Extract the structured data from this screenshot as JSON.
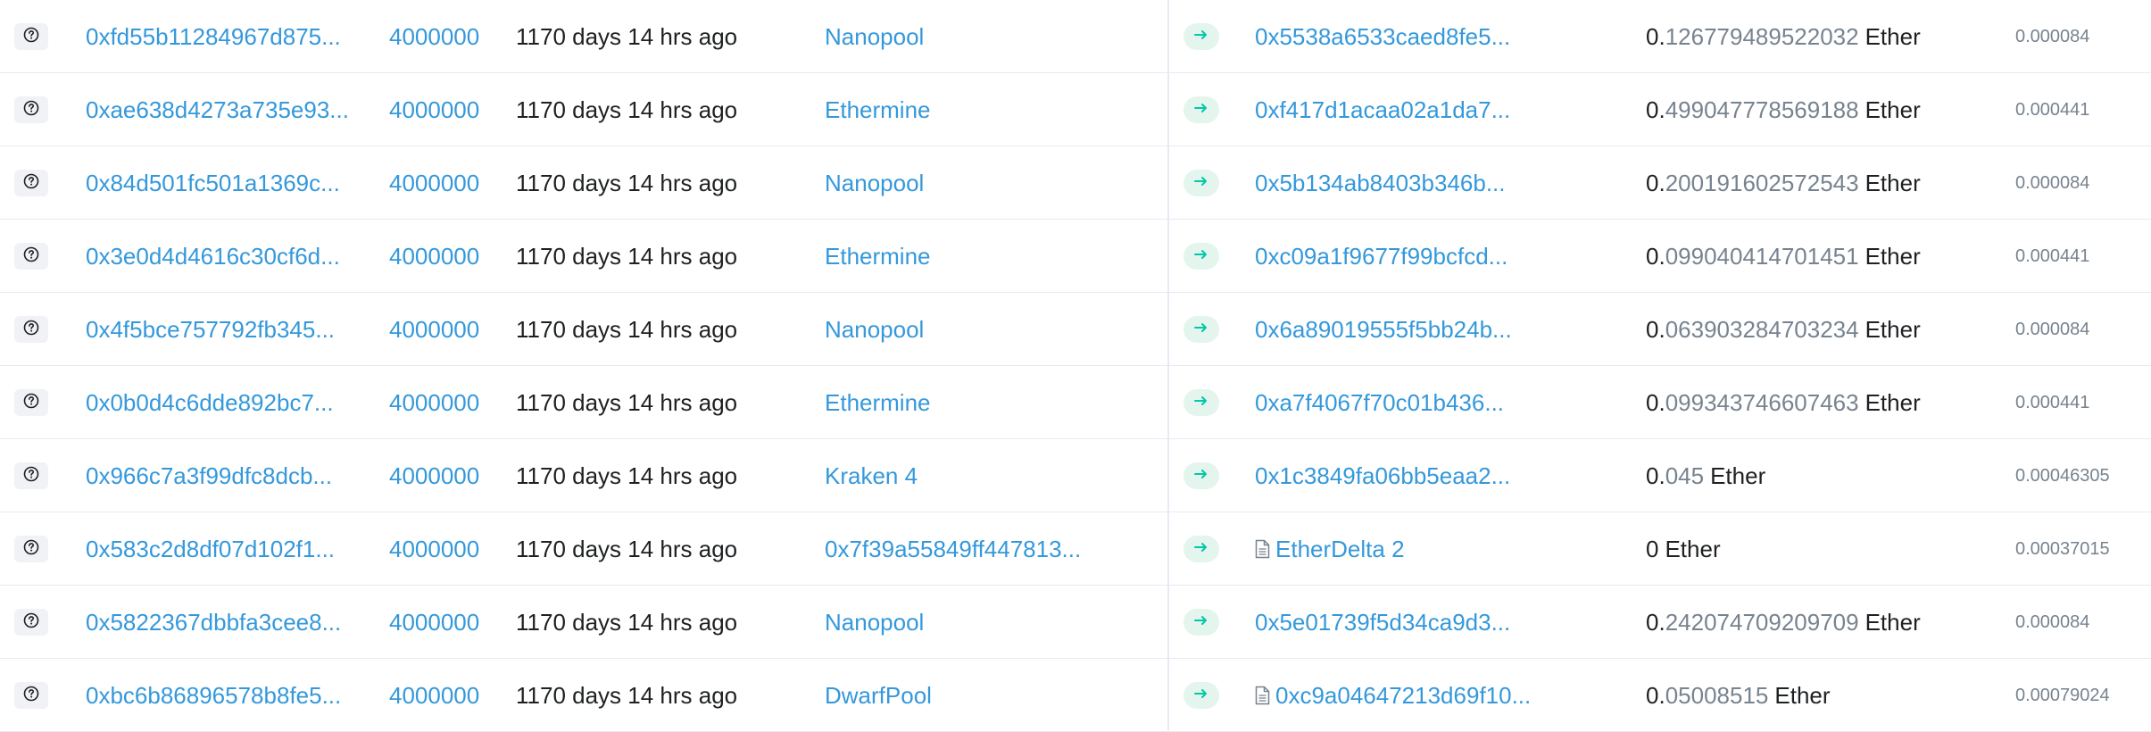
{
  "colors": {
    "link": "#3498db",
    "muted": "#77838f",
    "text": "#1e2022",
    "arrow_badge_bg": "#e4f5ee",
    "arrow": "#00c9a7",
    "divider": "#e7eaf3"
  },
  "icons": {
    "details": "question-circle-icon",
    "direction": "arrow-right-icon",
    "contract": "file-document-icon"
  },
  "rows": [
    {
      "hash": "0xfd55b11284967d875...",
      "block": "4000000",
      "age": "1170 days 14 hrs ago",
      "from": "Nanopool",
      "to": "0x5538a6533caed8fe5...",
      "to_is_contract": false,
      "value_int": "0.",
      "value_dec": "126779489522032",
      "value_unit": "Ether",
      "fee": "0.000084"
    },
    {
      "hash": "0xae638d4273a735e93...",
      "block": "4000000",
      "age": "1170 days 14 hrs ago",
      "from": "Ethermine",
      "to": "0xf417d1acaa02a1da7...",
      "to_is_contract": false,
      "value_int": "0.",
      "value_dec": "499047778569188",
      "value_unit": "Ether",
      "fee": "0.000441"
    },
    {
      "hash": "0x84d501fc501a1369c...",
      "block": "4000000",
      "age": "1170 days 14 hrs ago",
      "from": "Nanopool",
      "to": "0x5b134ab8403b346b...",
      "to_is_contract": false,
      "value_int": "0.",
      "value_dec": "200191602572543",
      "value_unit": "Ether",
      "fee": "0.000084"
    },
    {
      "hash": "0x3e0d4d4616c30cf6d...",
      "block": "4000000",
      "age": "1170 days 14 hrs ago",
      "from": "Ethermine",
      "to": "0xc09a1f9677f99bcfcd...",
      "to_is_contract": false,
      "value_int": "0.",
      "value_dec": "099040414701451",
      "value_unit": "Ether",
      "fee": "0.000441"
    },
    {
      "hash": "0x4f5bce757792fb345...",
      "block": "4000000",
      "age": "1170 days 14 hrs ago",
      "from": "Nanopool",
      "to": "0x6a89019555f5bb24b...",
      "to_is_contract": false,
      "value_int": "0.",
      "value_dec": "063903284703234",
      "value_unit": "Ether",
      "fee": "0.000084"
    },
    {
      "hash": "0x0b0d4c6dde892bc7...",
      "block": "4000000",
      "age": "1170 days 14 hrs ago",
      "from": "Ethermine",
      "to": "0xa7f4067f70c01b436...",
      "to_is_contract": false,
      "value_int": "0.",
      "value_dec": "099343746607463",
      "value_unit": "Ether",
      "fee": "0.000441"
    },
    {
      "hash": "0x966c7a3f99dfc8dcb...",
      "block": "4000000",
      "age": "1170 days 14 hrs ago",
      "from": "Kraken 4",
      "to": "0x1c3849fa06bb5eaa2...",
      "to_is_contract": false,
      "value_int": "0.",
      "value_dec": "045",
      "value_unit": "Ether",
      "fee": "0.00046305"
    },
    {
      "hash": "0x583c2d8df07d102f1...",
      "block": "4000000",
      "age": "1170 days 14 hrs ago",
      "from": "0x7f39a55849ff447813...",
      "to": "EtherDelta 2",
      "to_is_contract": true,
      "value_int": "0",
      "value_dec": "",
      "value_unit": "Ether",
      "fee": "0.00037015"
    },
    {
      "hash": "0x5822367dbbfa3cee8...",
      "block": "4000000",
      "age": "1170 days 14 hrs ago",
      "from": "Nanopool",
      "to": "0x5e01739f5d34ca9d3...",
      "to_is_contract": false,
      "value_int": "0.",
      "value_dec": "242074709209709",
      "value_unit": "Ether",
      "fee": "0.000084"
    },
    {
      "hash": "0xbc6b86896578b8fe5...",
      "block": "4000000",
      "age": "1170 days 14 hrs ago",
      "from": "DwarfPool",
      "to": "0xc9a04647213d69f10...",
      "to_is_contract": true,
      "value_int": "0.",
      "value_dec": "05008515",
      "value_unit": "Ether",
      "fee": "0.00079024"
    }
  ]
}
